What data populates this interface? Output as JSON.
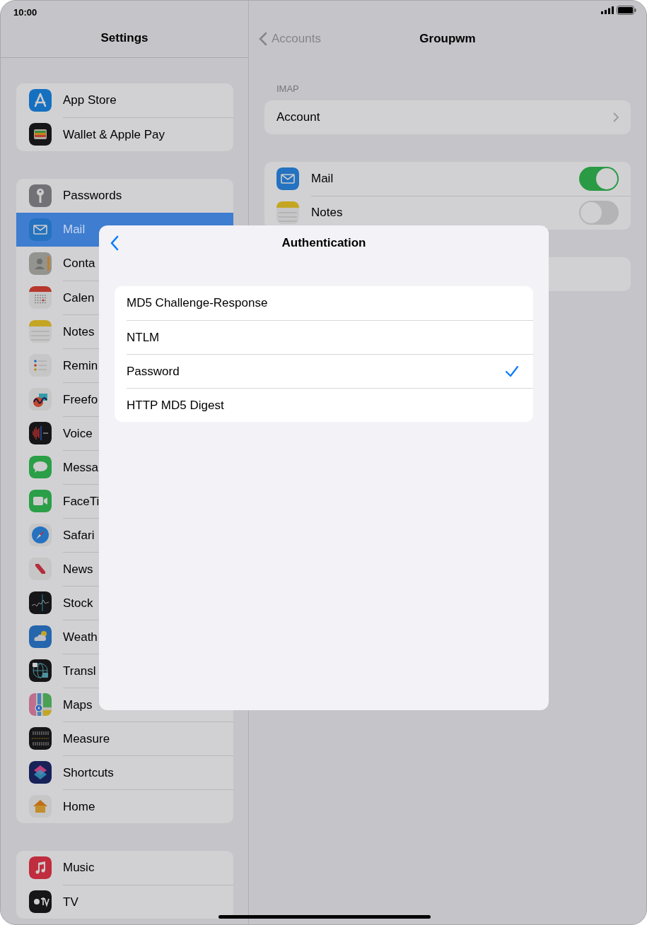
{
  "status_bar": {
    "time": "10:00"
  },
  "sidebar": {
    "title": "Settings",
    "groups": [
      {
        "items": [
          {
            "label": "App Store",
            "selected": false
          },
          {
            "label": "Wallet & Apple Pay",
            "selected": false
          }
        ]
      },
      {
        "items": [
          {
            "label": "Passwords",
            "selected": false
          },
          {
            "label": "Mail",
            "selected": true
          },
          {
            "label": "Conta",
            "selected": false
          },
          {
            "label": "Calen",
            "selected": false
          },
          {
            "label": "Notes",
            "selected": false
          },
          {
            "label": "Remin",
            "selected": false
          },
          {
            "label": "Freefo",
            "selected": false
          },
          {
            "label": "Voice",
            "selected": false
          },
          {
            "label": "Messa",
            "selected": false
          },
          {
            "label": "FaceTi",
            "selected": false
          },
          {
            "label": "Safari",
            "selected": false
          },
          {
            "label": "News",
            "selected": false
          },
          {
            "label": "Stock",
            "selected": false
          },
          {
            "label": "Weath",
            "selected": false
          },
          {
            "label": "Transl",
            "selected": false
          },
          {
            "label": "Maps",
            "selected": false
          },
          {
            "label": "Measure",
            "selected": false
          },
          {
            "label": "Shortcuts",
            "selected": false
          },
          {
            "label": "Home",
            "selected": false
          }
        ]
      },
      {
        "items": [
          {
            "label": "Music",
            "selected": false
          },
          {
            "label": "TV",
            "selected": false
          }
        ]
      }
    ]
  },
  "detail": {
    "back": "Accounts",
    "title": "Groupwm",
    "section_label": "IMAP",
    "account_row": "Account",
    "toggles": [
      {
        "label": "Mail",
        "on": true
      },
      {
        "label": "Notes",
        "on": false
      }
    ]
  },
  "sheet": {
    "title": "Authentication",
    "options": [
      {
        "label": "MD5 Challenge-Response",
        "selected": false
      },
      {
        "label": "NTLM",
        "selected": false
      },
      {
        "label": "Password",
        "selected": true
      },
      {
        "label": "HTTP MD5 Digest",
        "selected": false
      }
    ]
  }
}
